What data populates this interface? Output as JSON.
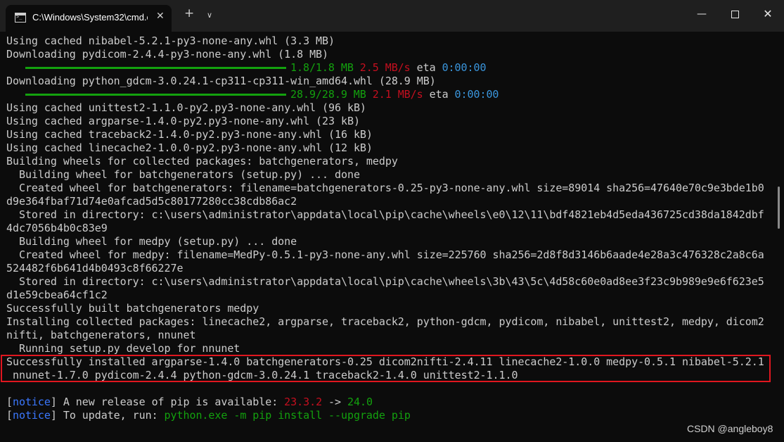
{
  "window": {
    "tab_title": "C:\\Windows\\System32\\cmd.e",
    "tab_close": "✕",
    "new_tab": "+",
    "dropdown": "∨",
    "minimize": "—",
    "close": "✕"
  },
  "terminal": {
    "lines": [
      "Using cached nibabel-5.2.1-py3-none-any.whl (3.3 MB)",
      "Downloading pydicom-2.4.4-py3-none-any.whl (1.8 MB)",
      "Downloading python_gdcm-3.0.24.1-cp311-cp311-win_amd64.whl (28.9 MB)",
      "Using cached unittest2-1.1.0-py2.py3-none-any.whl (96 kB)",
      "Using cached argparse-1.4.0-py2.py3-none-any.whl (23 kB)",
      "Using cached traceback2-1.4.0-py2.py3-none-any.whl (16 kB)",
      "Using cached linecache2-1.0.0-py2.py3-none-any.whl (12 kB)",
      "Building wheels for collected packages: batchgenerators, medpy",
      "  Building wheel for batchgenerators (setup.py) ... done",
      "  Created wheel for batchgenerators: filename=batchgenerators-0.25-py3-none-any.whl size=89014 sha256=47640e70c9e3bde1b0",
      "d9e364fbaf71d74e0afcad5d5c80177280cc38cdb86ac2",
      "  Stored in directory: c:\\users\\administrator\\appdata\\local\\pip\\cache\\wheels\\e0\\12\\11\\bdf4821eb4d5eda436725cd38da1842dbf",
      "4dc7056b4b0c83e9",
      "  Building wheel for medpy (setup.py) ... done",
      "  Created wheel for medpy: filename=MedPy-0.5.1-py3-none-any.whl size=225760 sha256=2d8f8d3146b6aade4e28a3c476328c2a8c6a",
      "524482f6b641d4b0493c8f66227e",
      "  Stored in directory: c:\\users\\administrator\\appdata\\local\\pip\\cache\\wheels\\3b\\43\\5c\\4d58c60e0ad8ee3f23c9b989e9e6f623e5",
      "d1e59cbea64cf1c2",
      "Successfully built batchgenerators medpy",
      "Installing collected packages: linecache2, argparse, traceback2, python-gdcm, pydicom, nibabel, unittest2, medpy, dicom2",
      "nifti, batchgenerators, nnunet",
      "  Running setup.py develop for nnunet",
      "Successfully installed argparse-1.4.0 batchgenerators-0.25 dicom2nifti-2.4.11 linecache2-1.0.0 medpy-0.5.1 nibabel-5.2.1",
      " nnunet-1.7.0 pydicom-2.4.4 python-gdcm-3.0.24.1 traceback2-1.4.0 unittest2-1.1.0"
    ],
    "progress": [
      {
        "fraction": 1.0,
        "done": "1.8/1.8 MB",
        "speed": "2.5 MB/s",
        "eta_label": "eta",
        "eta": "0:00:00"
      },
      {
        "fraction": 1.0,
        "done": "28.9/28.9 MB",
        "speed": "2.1 MB/s",
        "eta_label": "eta",
        "eta": "0:00:00"
      }
    ],
    "notice": {
      "tag": "notice",
      "line1_text": " A new release of pip is available: ",
      "old_version": "23.3.2",
      "arrow": " -> ",
      "new_version": "24.0",
      "line2_text": " To update, run: ",
      "command": "python.exe -m pip install --upgrade pip"
    }
  },
  "watermark": "CSDN @angleboy8",
  "colors": {
    "background": "#0c0c0c",
    "text": "#cccccc",
    "green": "#13a10e",
    "red": "#c50f1f",
    "blue": "#3a96dd",
    "notice_blue": "#3b78ff",
    "highlight_box": "#e0161f"
  }
}
